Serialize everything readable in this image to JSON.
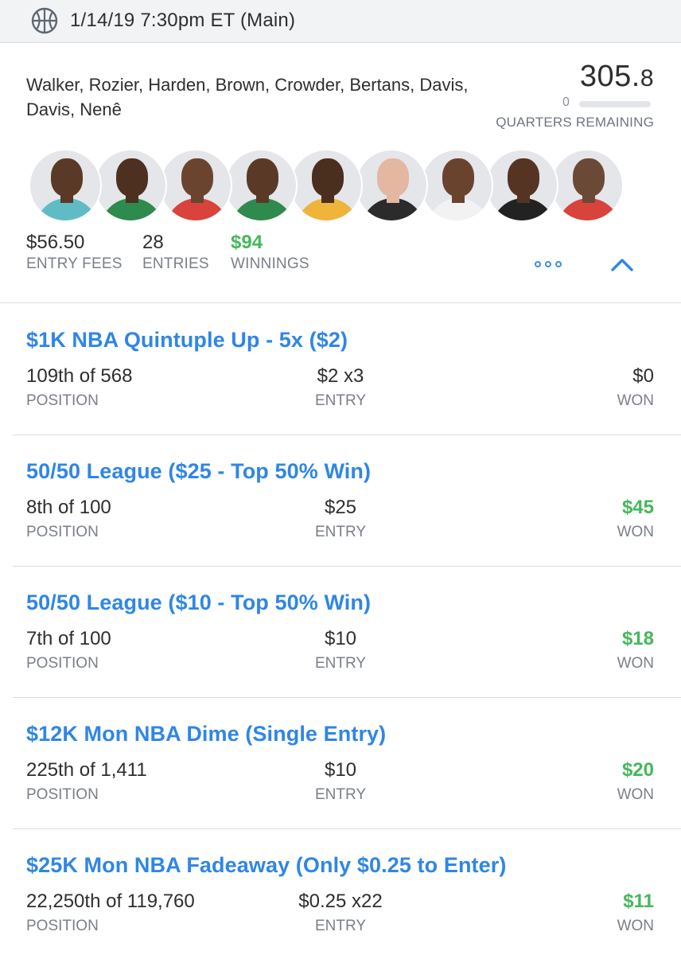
{
  "header": {
    "title": "1/14/19 7:30pm ET (Main)",
    "sport_icon": "basketball-icon"
  },
  "summary": {
    "lineup": "Walker, Rozier, Harden, Brown, Crowder, Bertans, Davis, Davis, Nenê",
    "score_whole": "305.",
    "score_decimal": "8",
    "quarters_remaining_value": "0",
    "quarters_progress": 0.0,
    "quarters_remaining_label": "QUARTERS REMAINING",
    "players": [
      {
        "name": "Walker",
        "jersey": "#5fbcc4",
        "skin": "#5a3a26"
      },
      {
        "name": "Rozier",
        "jersey": "#2f8a4e",
        "skin": "#4d3020"
      },
      {
        "name": "Harden",
        "jersey": "#d8433c",
        "skin": "#6b4430"
      },
      {
        "name": "Brown",
        "jersey": "#2f8a4e",
        "skin": "#5a3a26"
      },
      {
        "name": "Crowder",
        "jersey": "#f0b43a",
        "skin": "#4a2e1e"
      },
      {
        "name": "Bertans",
        "jersey": "#2b2b2b",
        "skin": "#e3b7a0"
      },
      {
        "name": "Davis",
        "jersey": "#f2f2f2",
        "skin": "#6a432e"
      },
      {
        "name": "Davis",
        "jersey": "#222222",
        "skin": "#553424"
      },
      {
        "name": "Nenê",
        "jersey": "#d8433c",
        "skin": "#6a4a36"
      }
    ],
    "entry_fees_value": "$56.50",
    "entry_fees_label": "ENTRY FEES",
    "entries_value": "28",
    "entries_label": "ENTRIES",
    "winnings_value": "$94",
    "winnings_label": "WINNINGS",
    "more_icon": "ellipsis-icon",
    "collapse_icon": "chevron-up-icon"
  },
  "labels": {
    "position": "POSITION",
    "entry": "ENTRY",
    "won": "WON"
  },
  "contests": [
    {
      "name": "$1K NBA Quintuple Up - 5x ($2)",
      "position": "109th of 568",
      "entry": "$2 x3",
      "won": "$0",
      "won_positive": false
    },
    {
      "name": "50/50 League ($25 - Top 50% Win)",
      "position": "8th of 100",
      "entry": "$25",
      "won": "$45",
      "won_positive": true
    },
    {
      "name": "50/50 League ($10 - Top 50% Win)",
      "position": "7th of 100",
      "entry": "$10",
      "won": "$18",
      "won_positive": true
    },
    {
      "name": "$12K Mon NBA Dime (Single Entry)",
      "position": "225th of 1,411",
      "entry": "$10",
      "won": "$20",
      "won_positive": true
    },
    {
      "name": "$25K Mon NBA Fadeaway (Only $0.25 to Enter)",
      "position": "22,250th of 119,760",
      "entry": "$0.25 x22",
      "won": "$11",
      "won_positive": true
    }
  ]
}
